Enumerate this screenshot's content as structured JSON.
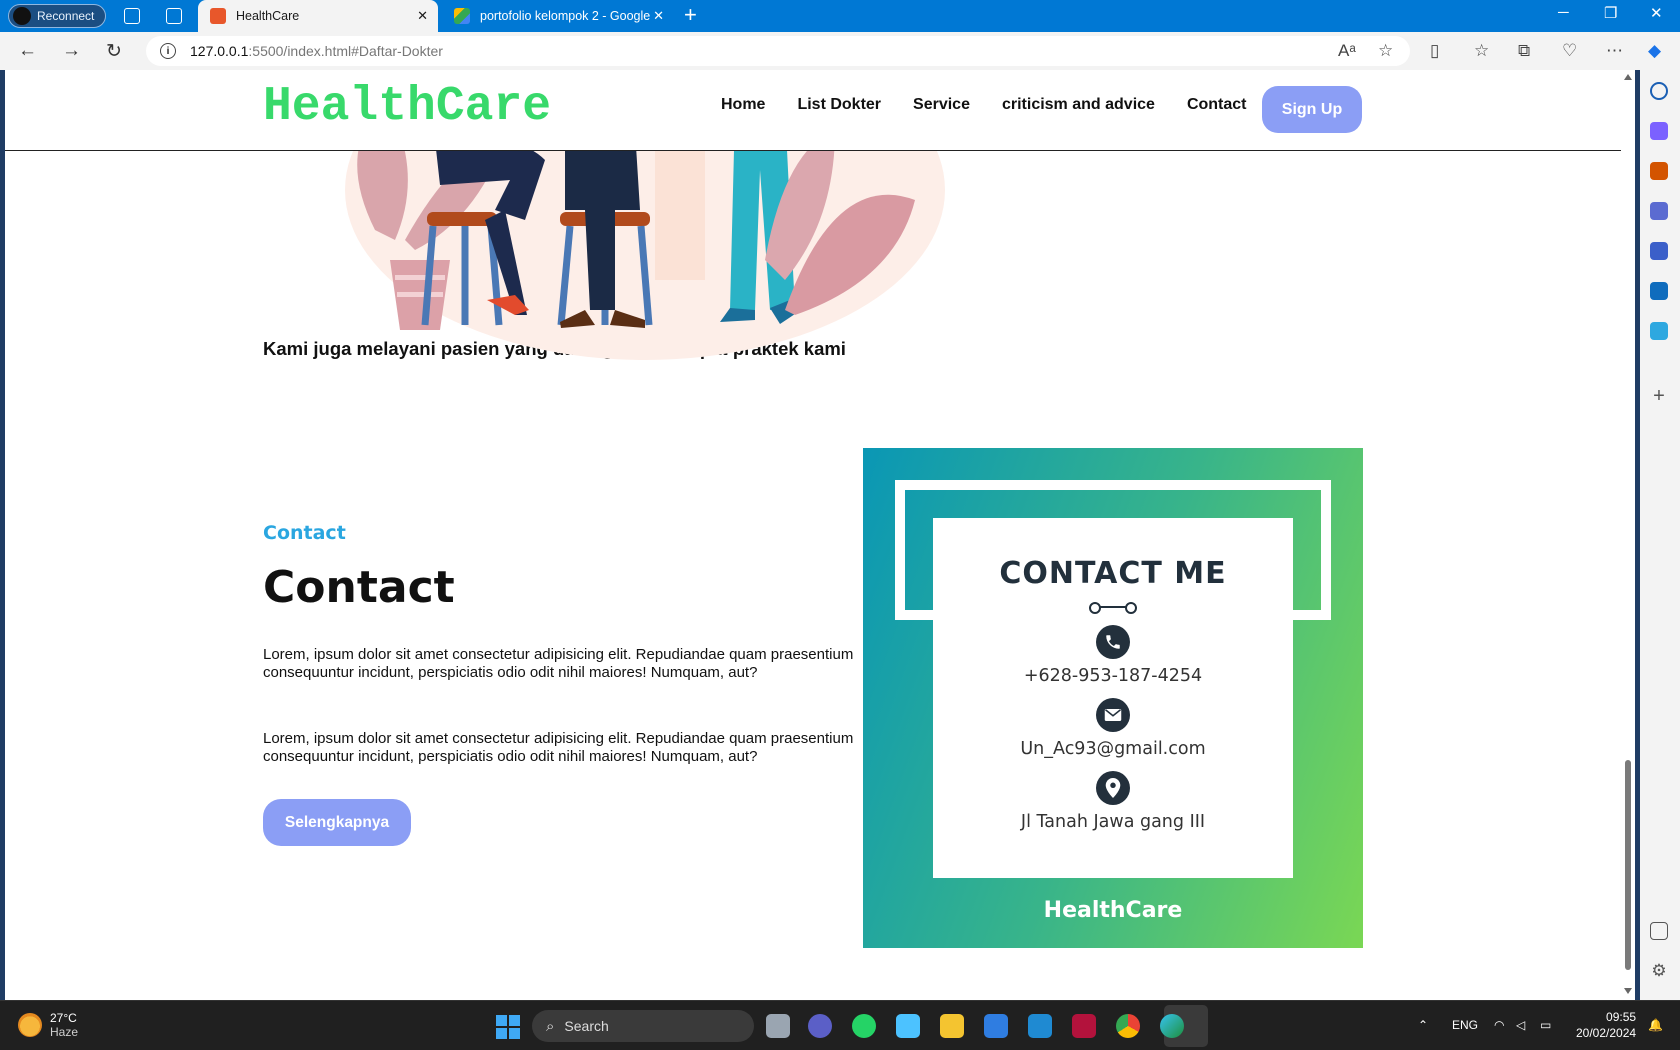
{
  "browser": {
    "reconnect_label": "Reconnect",
    "tabs": [
      {
        "title": "HealthCare",
        "active": true
      },
      {
        "title": "portofolio kelompok 2 - Google",
        "active": false
      }
    ],
    "url_host": "127.0.0.1",
    "url_path": ":5500/index.html#Daftar-Dokter"
  },
  "site": {
    "brand": "HealthCare",
    "nav": [
      "Home",
      "List Dokter",
      "Service",
      "criticism and advice",
      "Contact"
    ],
    "signup_label": "Sign Up",
    "tagline": "Kami juga melayani pasien yang datang pada tempat praktek kami",
    "contact": {
      "eyebrow": "Contact",
      "heading": "Contact",
      "paragraphs": [
        "Lorem, ipsum dolor sit amet consectetur adipisicing elit. Repudiandae quam praesentium consequuntur incidunt, perspiciatis odio odit nihil maiores! Numquam, aut?",
        "Lorem, ipsum dolor sit amet consectetur adipisicing elit. Repudiandae quam praesentium consequuntur incidunt, perspiciatis odio odit nihil maiores! Numquam, aut?"
      ],
      "button_label": "Selengkapnya"
    },
    "card": {
      "title": "CONTACT ME",
      "phone": "+628-953-187-4254",
      "email": "Un_Ac93@gmail.com",
      "address": "Jl Tanah Jawa gang III",
      "brand": "HealthCare"
    },
    "colors": {
      "brand_green": "#38d96b",
      "button_blue": "#8b9ef5",
      "eyebrow_blue": "#2aa6e0"
    }
  },
  "taskbar": {
    "temperature": "27°C",
    "condition": "Haze",
    "search_placeholder": "Search",
    "language": "ENG",
    "time": "09:55",
    "date": "20/02/2024"
  }
}
